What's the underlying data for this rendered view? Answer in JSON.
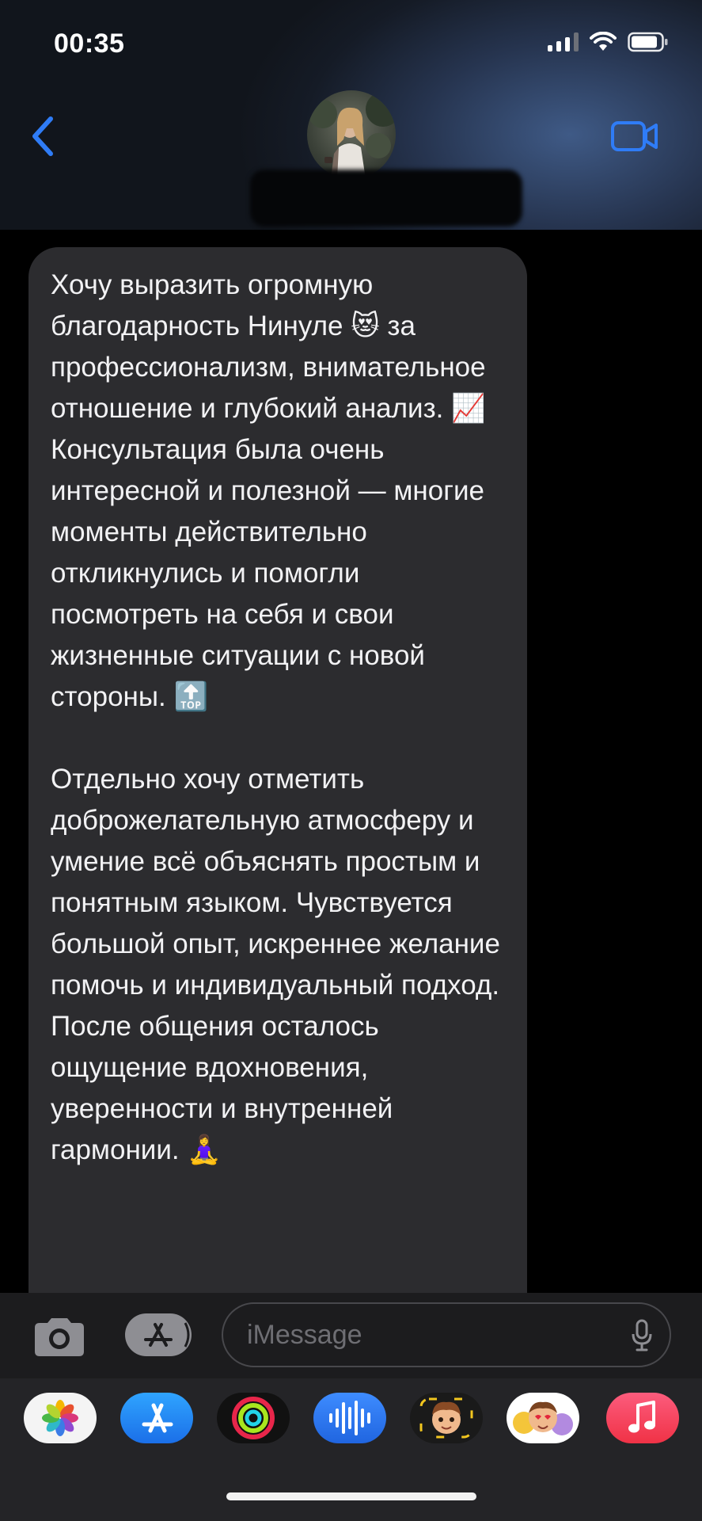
{
  "status_bar": {
    "time": "00:35",
    "icons": [
      "cellular-signal-icon",
      "wifi-icon",
      "battery-icon"
    ]
  },
  "header": {
    "back_icon": "chevron-left-icon",
    "video_icon": "video-camera-icon",
    "avatar": "contact-avatar",
    "accent_color": "#2f7cf6"
  },
  "message": {
    "paragraph1": "Хочу выразить огромную благодарность Нинуле 😻 за профессионализм, внимательное отношение и глубокий анализ. 📈 Консультация была очень интересной и полезной — многие моменты действительно откликнулись и помогли посмотреть на себя и свои жизненные ситуации с новой стороны. 🔝",
    "paragraph2": "Отдельно хочу отметить доброжелательную атмосферу и умение всё объяснять простым и понятным языком. Чувствуется большой опыт, искреннее желание помочь и индивидуальный подход. После общения осталось ощущение вдохновения, уверенности и внутренней гармонии. 🧘‍♀️",
    "bubble_color": "#2c2c2f"
  },
  "compose": {
    "placeholder": "iMessage",
    "camera_icon": "camera-icon",
    "apps_icon": "app-store-icon",
    "mic_icon": "microphone-icon"
  },
  "app_drawer": {
    "apps": [
      "photos-app-icon",
      "app-store-app-icon",
      "activity-app-icon",
      "audio-message-app-icon",
      "memoji-app-icon",
      "memoji-stickers-app-icon",
      "music-app-icon"
    ]
  }
}
